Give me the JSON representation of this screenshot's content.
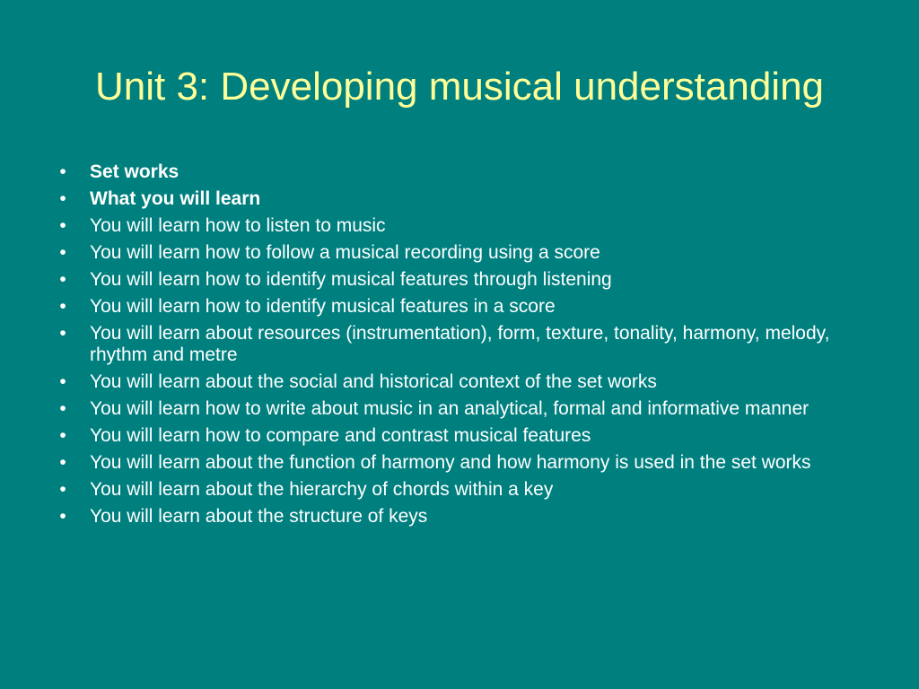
{
  "slide": {
    "title": "Unit 3: Developing musical understanding",
    "bullet_glyph": "•",
    "items": [
      {
        "text": "Set works",
        "bold": true
      },
      {
        "text": "What you will learn",
        "bold": true
      },
      {
        "text": "You will learn how to listen to music",
        "bold": false
      },
      {
        "text": "You will learn how to follow a musical recording using a score",
        "bold": false
      },
      {
        "text": "You will learn how to identify musical features through listening",
        "bold": false
      },
      {
        "text": "You will learn how to identify musical features in a score",
        "bold": false
      },
      {
        "text": "You will learn about resources (instrumentation), form, texture, tonality, harmony, melody, rhythm and metre",
        "bold": false
      },
      {
        "text": "You will learn about the social and historical context of the set works",
        "bold": false
      },
      {
        "text": "You will learn how to write about music in an analytical, formal and informative manner",
        "bold": false
      },
      {
        "text": "You will learn how to compare and contrast musical features",
        "bold": false
      },
      {
        "text": "You will learn about the function of harmony and how harmony is used in the set works",
        "bold": false
      },
      {
        "text": "You will learn about the hierarchy of chords within a key",
        "bold": false
      },
      {
        "text": "You will learn about the structure of keys",
        "bold": false
      }
    ]
  },
  "colors": {
    "background": "#007f7f",
    "title": "#ffff99",
    "body_text": "#ffffff"
  }
}
